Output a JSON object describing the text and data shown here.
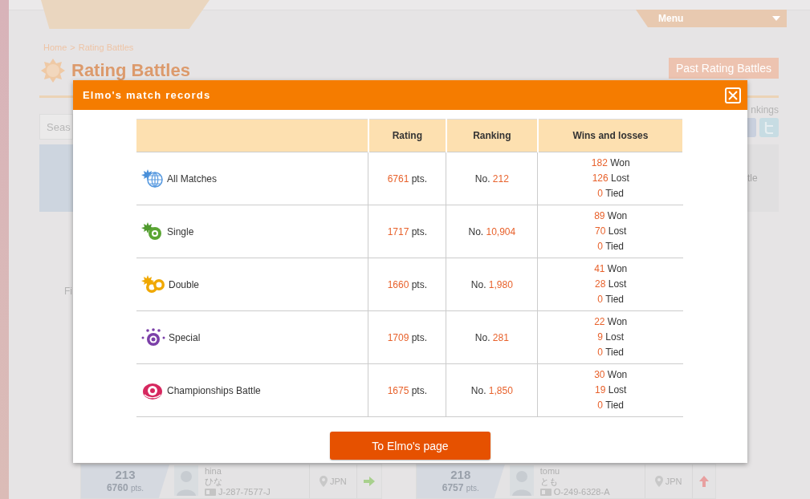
{
  "header": {
    "menu": "Menu"
  },
  "breadcrumb": {
    "items": [
      {
        "label": "Home"
      },
      {
        "label": "Rating Battles"
      }
    ],
    "separator": ">"
  },
  "page_title": "Rating Battles",
  "past_button": "Past Rating Battles",
  "rankings_label": "nkings",
  "search": {
    "placeholder": "Seas"
  },
  "tab_label_fragment": "tle",
  "filter_label_fragment": "Fi",
  "dialog": {
    "title": "Elmo's match records",
    "columns": [
      "Rating",
      "Ranking",
      "Wins and losses"
    ],
    "rows": [
      {
        "name": "All Matches",
        "rating": "6761",
        "rating_unit": "pts.",
        "rank_prefix": "No.",
        "rank": "212",
        "record": [
          {
            "count": "182",
            "label": "Won"
          },
          {
            "count": "126",
            "label": "Lost"
          },
          {
            "count": "0",
            "label": "Tied"
          }
        ]
      },
      {
        "name": "Single",
        "rating": "1717",
        "rating_unit": "pts.",
        "rank_prefix": "No.",
        "rank": "10,904",
        "record": [
          {
            "count": "89",
            "label": "Won"
          },
          {
            "count": "70",
            "label": "Lost"
          },
          {
            "count": "0",
            "label": "Tied"
          }
        ]
      },
      {
        "name": "Double",
        "rating": "1660",
        "rating_unit": "pts.",
        "rank_prefix": "No.",
        "rank": "1,980",
        "record": [
          {
            "count": "41",
            "label": "Won"
          },
          {
            "count": "28",
            "label": "Lost"
          },
          {
            "count": "0",
            "label": "Tied"
          }
        ]
      },
      {
        "name": "Special",
        "rating": "1709",
        "rating_unit": "pts.",
        "rank_prefix": "No.",
        "rank": "281",
        "record": [
          {
            "count": "22",
            "label": "Won"
          },
          {
            "count": "9",
            "label": "Lost"
          },
          {
            "count": "0",
            "label": "Tied"
          }
        ]
      },
      {
        "name": "Championships Battle",
        "rating": "1675",
        "rating_unit": "pts.",
        "rank_prefix": "No.",
        "rank": "1,850",
        "record": [
          {
            "count": "30",
            "label": "Won"
          },
          {
            "count": "19",
            "label": "Lost"
          },
          {
            "count": "0",
            "label": "Tied"
          }
        ]
      }
    ],
    "button": "To Elmo's page"
  },
  "players": [
    {
      "rank": "213",
      "points": "6760",
      "points_unit": "pts.",
      "name": "hina",
      "kana": "ひな",
      "player_id": "J-287-7577-J",
      "country": "JPN",
      "rank_up": false
    },
    {
      "rank": "218",
      "points": "6757",
      "points_unit": "pts.",
      "name": "tomu",
      "kana": "とも",
      "player_id": "O-249-6328-A",
      "country": "JPN",
      "rank_up": true
    }
  ]
}
